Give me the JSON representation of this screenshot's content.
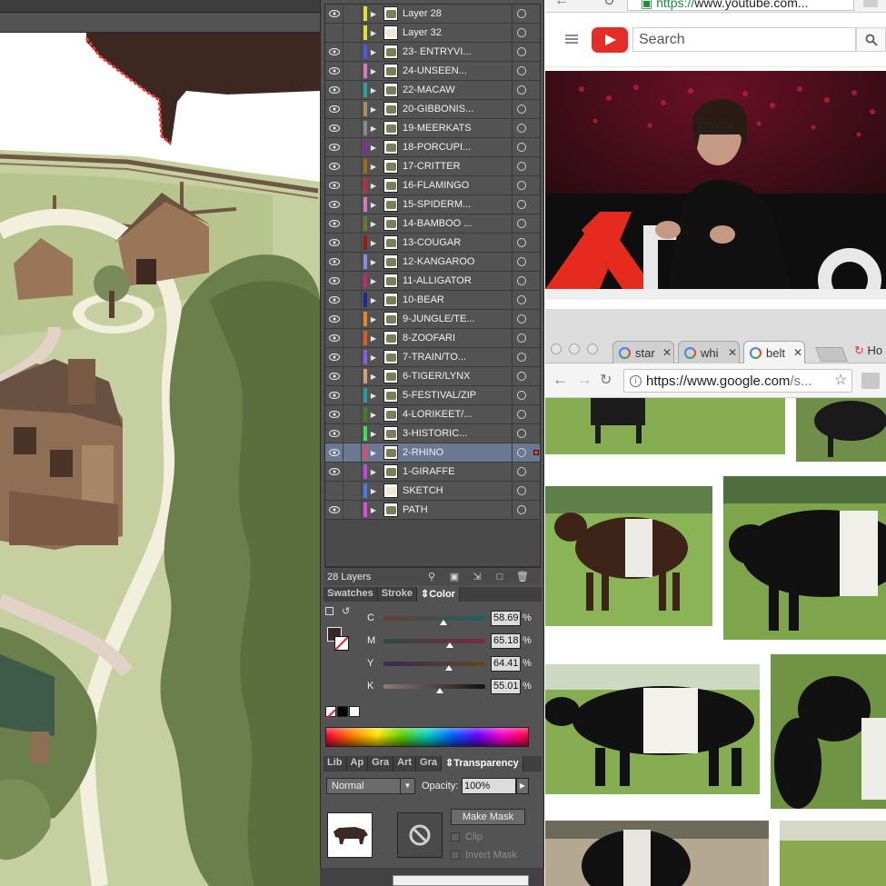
{
  "illustrator": {
    "layers": [
      {
        "name": "Layer 28",
        "visible": true,
        "color": "#e0e030"
      },
      {
        "name": "Layer 32",
        "visible": false,
        "color": "#e0e030"
      },
      {
        "name": "23- ENTRYVI...",
        "visible": true,
        "color": "#4a5ad8"
      },
      {
        "name": "24-UNSEEN...",
        "visible": true,
        "color": "#d878c0"
      },
      {
        "name": "22-MACAW",
        "visible": true,
        "color": "#2aa0a0"
      },
      {
        "name": "20-GIBBONIS...",
        "visible": true,
        "color": "#b08a5a"
      },
      {
        "name": "19-MEERKATS",
        "visible": true,
        "color": "#8a8a8a"
      },
      {
        "name": "18-PORCUPI...",
        "visible": true,
        "color": "#8a2a9a"
      },
      {
        "name": "17-CRITTER",
        "visible": true,
        "color": "#9a6a20"
      },
      {
        "name": "16-FLAMINGO",
        "visible": true,
        "color": "#c02a4a"
      },
      {
        "name": "15-SPIDERM...",
        "visible": true,
        "color": "#d878c0"
      },
      {
        "name": "14-BAMBOO ...",
        "visible": true,
        "color": "#6a7a2a"
      },
      {
        "name": "13-COUGAR",
        "visible": true,
        "color": "#9a1a1a"
      },
      {
        "name": "12-KANGAROO",
        "visible": true,
        "color": "#8a8ae0"
      },
      {
        "name": "11-ALLIGATOR",
        "visible": true,
        "color": "#c02a6a"
      },
      {
        "name": "10-BEAR",
        "visible": true,
        "color": "#1a2a9a"
      },
      {
        "name": "9-JUNGLE/TE...",
        "visible": true,
        "color": "#e08a20"
      },
      {
        "name": "8-ZOOFARI",
        "visible": true,
        "color": "#e05a20"
      },
      {
        "name": "7-TRAIN/TO...",
        "visible": true,
        "color": "#8a5ae0"
      },
      {
        "name": "6-TIGER/LYNX",
        "visible": true,
        "color": "#d8a070"
      },
      {
        "name": "5-FESTIVAL/ZIP",
        "visible": true,
        "color": "#2a9aa0"
      },
      {
        "name": "4-LORIKEET/...",
        "visible": true,
        "color": "#4a7a2a"
      },
      {
        "name": "3-HISTORIC...",
        "visible": true,
        "color": "#3ae05a"
      },
      {
        "name": "2-RHINO",
        "visible": true,
        "color": "#e04a6a",
        "selected": true
      },
      {
        "name": "1-GIRAFFE",
        "visible": true,
        "color": "#c04ad8"
      },
      {
        "name": "SKETCH",
        "visible": false,
        "color": "#4a7ae0"
      },
      {
        "name": "PATH",
        "visible": true,
        "color": "#e04ad8"
      }
    ],
    "layers_count": "28 Layers",
    "color_tabs": [
      "Swatches",
      "Stroke",
      "Color"
    ],
    "color": {
      "C": {
        "label": "C",
        "value": "58.69",
        "fraction": 0.587
      },
      "M": {
        "label": "M",
        "value": "65.18",
        "fraction": 0.652
      },
      "Y": {
        "label": "Y",
        "value": "64.41",
        "fraction": 0.644
      },
      "K": {
        "label": "K",
        "value": "55.01",
        "fraction": 0.55
      },
      "pct": "%"
    },
    "transparency_tabs": [
      "Lib",
      "Ap",
      "Gra",
      "Art",
      "Gra",
      "Transparency"
    ],
    "transparency": {
      "blend_mode": "Normal",
      "opacity_label": "Opacity:",
      "opacity_value": "100%",
      "make_mask": "Make Mask",
      "clip": "Clip",
      "invert_mask": "Invert Mask"
    }
  },
  "youtube_window": {
    "url_scheme": "https://",
    "url_rest": "www.youtube.com...",
    "search_placeholder": "Search"
  },
  "google_window": {
    "tabs": [
      {
        "title": "star",
        "active": false
      },
      {
        "title": "whi",
        "active": false
      },
      {
        "title": "belt",
        "active": true
      }
    ],
    "partial_tab": "Ho",
    "url_host": "https://www.google.com",
    "url_path": "/s..."
  },
  "colors": {
    "panel_bg": "#535353",
    "selected_row": "#6a7891",
    "youtube_red": "#e52d27",
    "https_green": "#1f8a3b"
  }
}
